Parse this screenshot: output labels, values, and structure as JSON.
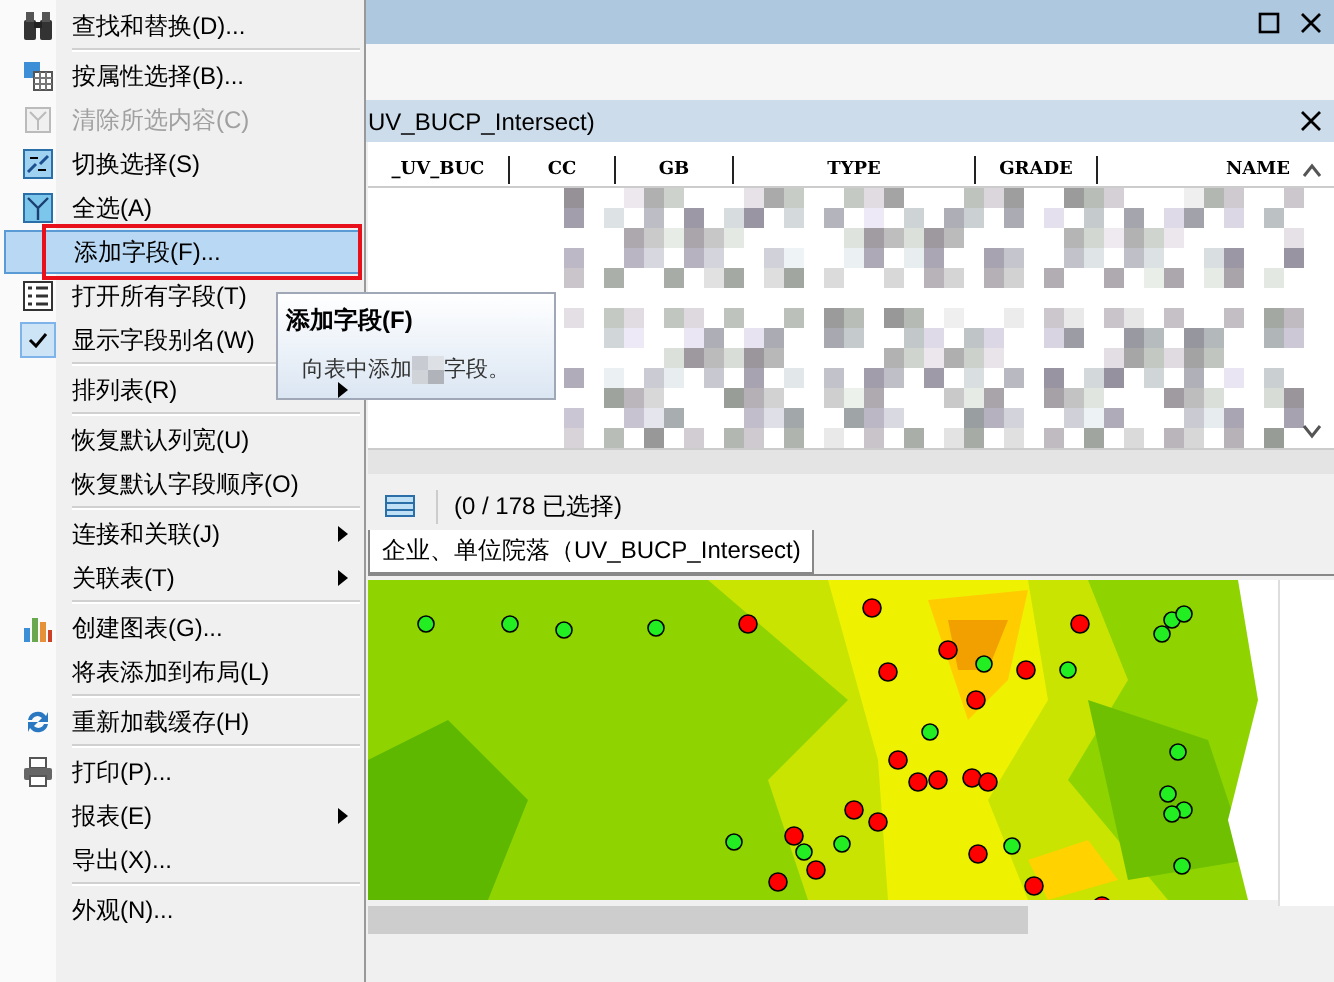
{
  "menu": {
    "items": [
      {
        "label": "查找和替换(D)...",
        "kind": "binoculars",
        "disabled": false,
        "selected": false,
        "separator_before": false,
        "submenu": false,
        "circled": false
      },
      {
        "label": "按属性选择(B)...",
        "kind": "table-select",
        "disabled": false,
        "selected": false,
        "separator_before": true,
        "submenu": false,
        "circled": false
      },
      {
        "label": "清除所选内容(C)",
        "kind": "clear",
        "disabled": true,
        "selected": false,
        "separator_before": false,
        "submenu": false,
        "circled": false
      },
      {
        "label": "切换选择(S)",
        "kind": "switch",
        "disabled": false,
        "selected": false,
        "separator_before": false,
        "submenu": false,
        "circled": false
      },
      {
        "label": "全选(A)",
        "kind": "select-all",
        "disabled": false,
        "selected": false,
        "separator_before": false,
        "submenu": false,
        "circled": false
      },
      {
        "label": "添加字段(F)...",
        "kind": "plain",
        "disabled": false,
        "selected": true,
        "separator_before": false,
        "submenu": false,
        "circled": true
      },
      {
        "label": "打开所有字段(T)",
        "kind": "list",
        "disabled": false,
        "selected": false,
        "separator_before": false,
        "submenu": false,
        "circled": false
      },
      {
        "label": "显示字段别名(W)",
        "kind": "check",
        "disabled": false,
        "selected": false,
        "separator_before": false,
        "submenu": false,
        "circled": false
      },
      {
        "label": "排列表(R)",
        "kind": "plain",
        "disabled": false,
        "selected": false,
        "separator_before": true,
        "submenu": true,
        "circled": false
      },
      {
        "label": "恢复默认列宽(U)",
        "kind": "plain",
        "disabled": false,
        "selected": false,
        "separator_before": true,
        "submenu": false,
        "circled": false
      },
      {
        "label": "恢复默认字段顺序(O)",
        "kind": "plain",
        "disabled": false,
        "selected": false,
        "separator_before": false,
        "submenu": false,
        "circled": false
      },
      {
        "label": "连接和关联(J)",
        "kind": "plain",
        "disabled": false,
        "selected": false,
        "separator_before": true,
        "submenu": true,
        "circled": false
      },
      {
        "label": "关联表(T)",
        "kind": "plain",
        "disabled": false,
        "selected": false,
        "separator_before": false,
        "submenu": true,
        "circled": false
      },
      {
        "label": "创建图表(G)...",
        "kind": "chart",
        "disabled": false,
        "selected": false,
        "separator_before": true,
        "submenu": false,
        "circled": false
      },
      {
        "label": "将表添加到布局(L)",
        "kind": "plain",
        "disabled": false,
        "selected": false,
        "separator_before": false,
        "submenu": false,
        "circled": false
      },
      {
        "label": "重新加载缓存(H)",
        "kind": "refresh",
        "disabled": false,
        "selected": false,
        "separator_before": true,
        "submenu": false,
        "circled": false
      },
      {
        "label": "打印(P)...",
        "kind": "printer",
        "disabled": false,
        "selected": false,
        "separator_before": true,
        "submenu": false,
        "circled": false
      },
      {
        "label": "报表(E)",
        "kind": "plain",
        "disabled": false,
        "selected": false,
        "separator_before": false,
        "submenu": true,
        "circled": false
      },
      {
        "label": "导出(X)...",
        "kind": "plain",
        "disabled": false,
        "selected": false,
        "separator_before": false,
        "submenu": false,
        "circled": false
      },
      {
        "label": "外观(N)...",
        "kind": "plain",
        "disabled": false,
        "selected": false,
        "separator_before": true,
        "submenu": false,
        "circled": false
      }
    ]
  },
  "tooltip": {
    "title": "添加字段(F)",
    "description_start": "向表中添加",
    "description_end": "字段。"
  },
  "table_window": {
    "title": "UV_BUCP_Intersect)",
    "columns": [
      "_UV_BUC",
      "CC",
      "GB",
      "TYPE",
      "GRADE",
      "NAME"
    ],
    "selection_count": "(0 / 178 已选择)",
    "tabs": [
      {
        "label": "企业、单位院落（UV_BUCP_Intersect)",
        "selected": true
      }
    ]
  }
}
